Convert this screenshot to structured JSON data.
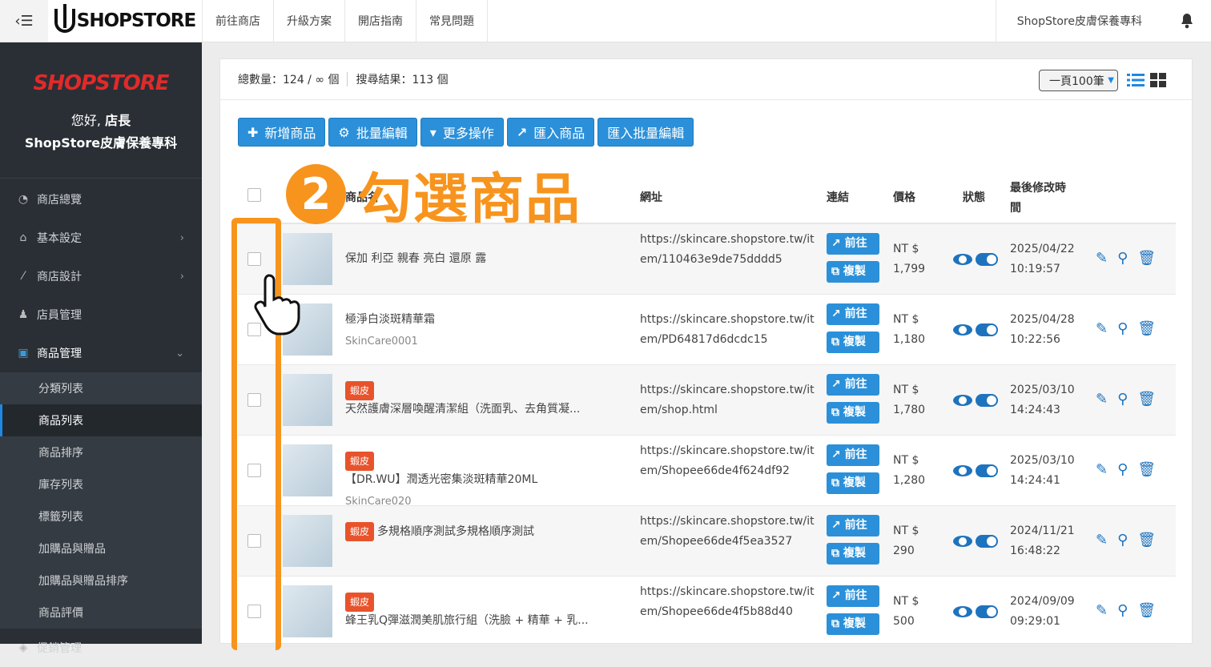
{
  "topbar": {
    "logo": "SHOPSTORE",
    "nav": [
      "前往商店",
      "升級方案",
      "開店指南",
      "常見問題"
    ],
    "store_name": "ShopStore皮膚保養專科"
  },
  "sidebar": {
    "brand": "SHOPSTORE",
    "greeting_prefix": "您好,",
    "greeting_role": "店長",
    "greeting_store": "ShopStore皮膚保養專科",
    "items": [
      {
        "label": "商店總覽",
        "icon": "dashboard-icon"
      },
      {
        "label": "基本設定",
        "icon": "bank-icon"
      },
      {
        "label": "商店設計",
        "icon": "magic-wand-icon"
      },
      {
        "label": "店員管理",
        "icon": "user-icon"
      },
      {
        "label": "商品管理",
        "icon": "cart-icon"
      }
    ],
    "sub_items": [
      "分類列表",
      "商品列表",
      "商品排序",
      "庫存列表",
      "標籤列表",
      "加購品與贈品",
      "加購品與贈品排序",
      "商品評價"
    ],
    "next_item": "促銷管理"
  },
  "summary": {
    "total": "總數量：124 / ∞ 個",
    "results": "搜尋結果：113 個",
    "per_page": "一頁100筆"
  },
  "toolbar": {
    "add": "新增商品",
    "bulk_edit": "批量編輯",
    "more": "更多操作",
    "import": "匯入商品",
    "import_bulk": "匯入批量編輯"
  },
  "table": {
    "headers": {
      "name": "商品名",
      "url": "網址",
      "link": "連結",
      "price": "價格",
      "status": "狀態",
      "modified": "最後修改時間"
    },
    "go_label": "前往",
    "copy_label": "複製",
    "rows": [
      {
        "name": "保加 利亞 親春 亮白 還原 露",
        "tag": "",
        "sku": "",
        "url": "https://skincare.shopstore.tw/item/110463e9de75dddd5",
        "price_cur": "NT $",
        "price": "1,799",
        "date": "2025/04/22",
        "time": "10:19:57"
      },
      {
        "name": "極淨白淡斑精華霜",
        "tag": "",
        "sku": "SkinCare0001",
        "url": "https://skincare.shopstore.tw/item/PD64817d6dcdc15",
        "price_cur": "NT $",
        "price": "1,180",
        "date": "2025/04/28",
        "time": "10:22:56"
      },
      {
        "name": "天然護膚深層喚醒清潔組（洗面乳、去角質凝...",
        "tag": "蝦皮",
        "sku": "",
        "url": "https://skincare.shopstore.tw/item/shop.html",
        "price_cur": "NT $",
        "price": "1,780",
        "date": "2025/03/10",
        "time": "14:24:43"
      },
      {
        "name": "【DR.WU】潤透光密集淡斑精華20ML",
        "tag": "蝦皮",
        "sku": "SkinCare020",
        "url": "https://skincare.shopstore.tw/item/Shopee66de4f624df92",
        "price_cur": "NT $",
        "price": "1,280",
        "date": "2025/03/10",
        "time": "14:24:41"
      },
      {
        "name": "多規格順序測試多規格順序測試",
        "tag": "蝦皮",
        "sku": "",
        "url": "https://skincare.shopstore.tw/item/Shopee66de4f5ea3527",
        "price_cur": "NT $",
        "price": "290",
        "date": "2024/11/21",
        "time": "16:48:22"
      },
      {
        "name": "蜂王乳Q彈滋潤美肌旅行組（洗臉 + 精華 + 乳...",
        "tag": "蝦皮",
        "sku": "",
        "url": "https://skincare.shopstore.tw/item/Shopee66de4f5b88d40",
        "price_cur": "NT $",
        "price": "500",
        "date": "2024/09/09",
        "time": "09:29:01"
      }
    ]
  },
  "annotation": {
    "step": "2",
    "text": "勾選商品"
  },
  "colors": {
    "accent": "#2b90d9",
    "sidebar": "#2a2f35",
    "annotation": "#f7941d",
    "tag": "#e8532b"
  }
}
